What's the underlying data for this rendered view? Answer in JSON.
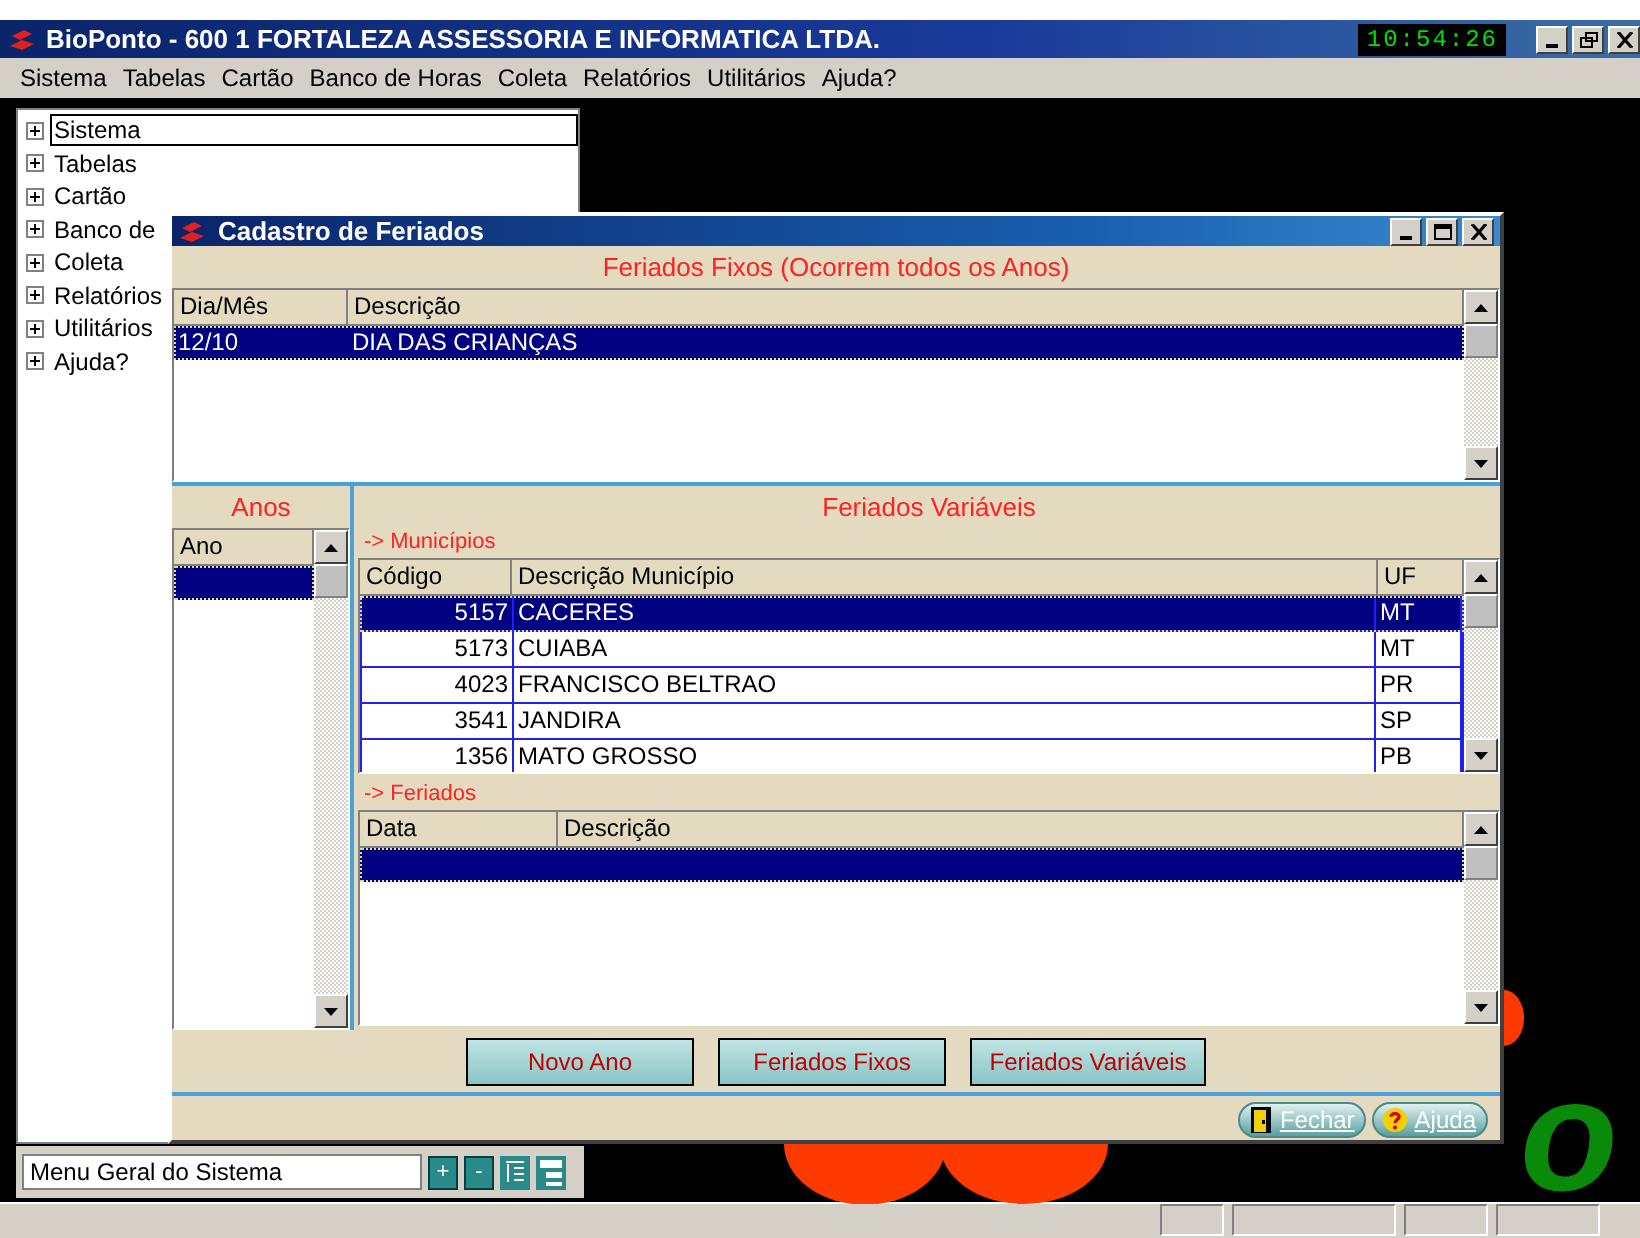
{
  "app": {
    "title": "BioPonto - 600 1 FORTALEZA ASSESSORIA E INFORMATICA LTDA.",
    "clock": "10:54:26"
  },
  "menu": [
    "Sistema",
    "Tabelas",
    "Cartão",
    "Banco de Horas",
    "Coleta",
    "Relatórios",
    "Utilitários",
    "Ajuda?"
  ],
  "tree": {
    "items": [
      {
        "label": "Sistema",
        "selected": true
      },
      {
        "label": "Tabelas",
        "selected": false
      },
      {
        "label": "Cartão",
        "selected": false
      },
      {
        "label": "Banco de",
        "selected": false
      },
      {
        "label": "Coleta",
        "selected": false
      },
      {
        "label": "Relatórios",
        "selected": false
      },
      {
        "label": "Utilitários",
        "selected": false
      },
      {
        "label": "Ajuda?",
        "selected": false
      }
    ]
  },
  "tree_footer": {
    "value": "Menu Geral do Sistema",
    "buttons": [
      "+",
      "-"
    ]
  },
  "background_logo": "o",
  "dialog": {
    "title": "Cadastro de Feriados",
    "fixed": {
      "heading": "Feriados Fixos (Ocorrem todos os Anos)",
      "columns": [
        "Dia/Mês",
        "Descrição"
      ],
      "rows": [
        {
          "cells": [
            "12/10",
            "DIA DAS CRIANÇAS"
          ],
          "selected": true
        }
      ]
    },
    "years": {
      "heading": "Anos",
      "columns": [
        "Ano"
      ],
      "rows": [
        {
          "selected": true
        }
      ]
    },
    "variable": {
      "heading": "Feriados Variáveis",
      "municipalities": {
        "label": "-> Municípios",
        "columns": [
          "Código",
          "Descrição Município",
          "UF"
        ],
        "rows": [
          {
            "cells": [
              "5157",
              "CACERES",
              "MT"
            ],
            "selected": true
          },
          {
            "cells": [
              "5173",
              "CUIABA",
              "MT"
            ],
            "selected": false
          },
          {
            "cells": [
              "4023",
              "FRANCISCO BELTRAO",
              "PR"
            ],
            "selected": false
          },
          {
            "cells": [
              "3541",
              "JANDIRA",
              "SP"
            ],
            "selected": false
          },
          {
            "cells": [
              "1356",
              "MATO GROSSO",
              "PB"
            ],
            "selected": false
          }
        ]
      },
      "holidays": {
        "label": "-> Feriados",
        "columns": [
          "Data",
          "Descrição"
        ],
        "rows": [
          {
            "selected": true
          }
        ]
      }
    },
    "buttons": [
      "Novo Ano",
      "Feriados Fixos",
      "Feriados Variáveis"
    ],
    "footer_buttons": [
      {
        "kind": "exit",
        "label": "Fechar"
      },
      {
        "kind": "help",
        "label": "Ajuda"
      }
    ]
  }
}
